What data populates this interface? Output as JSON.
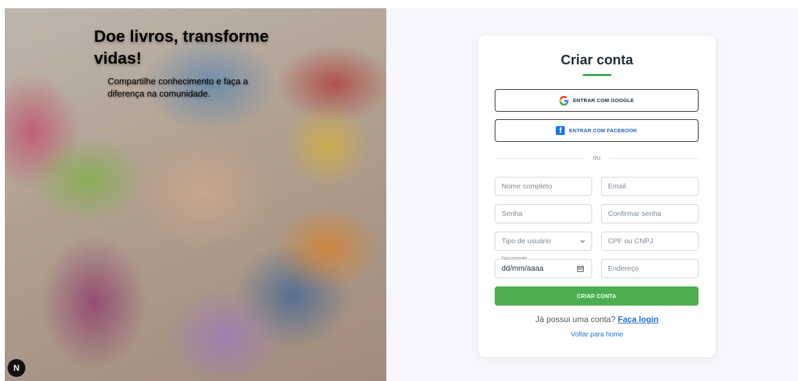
{
  "hero": {
    "title": "Doe livros, transforme vidas!",
    "subtitle": "Compartilhe conhecimento e faça a diferença na comunidade.",
    "dev_badge": "N"
  },
  "card": {
    "title": "Criar conta",
    "google_label": "ENTRAR COM GOOGLE",
    "facebook_label": "ENTRAR COM FACEBOOK",
    "divider_text": "ou",
    "fields": {
      "full_name": "Nome completo",
      "email": "Email",
      "password": "Senha",
      "confirm_password": "Confirmar senha",
      "user_type": "Tipo de usuário",
      "document": "CPF ou CNPJ",
      "birth_label": "Nascimento",
      "birth_value": "dd/mm/aaaa",
      "address": "Endereço"
    },
    "submit_label": "CRIAR CONTA",
    "have_account_text": "Já possui uma conta?",
    "login_link": "Faça login",
    "home_link": "Voltar para home"
  },
  "colors": {
    "accent": "#4cae4f",
    "link": "#1f6fcf",
    "background": "#f5f7fa"
  }
}
